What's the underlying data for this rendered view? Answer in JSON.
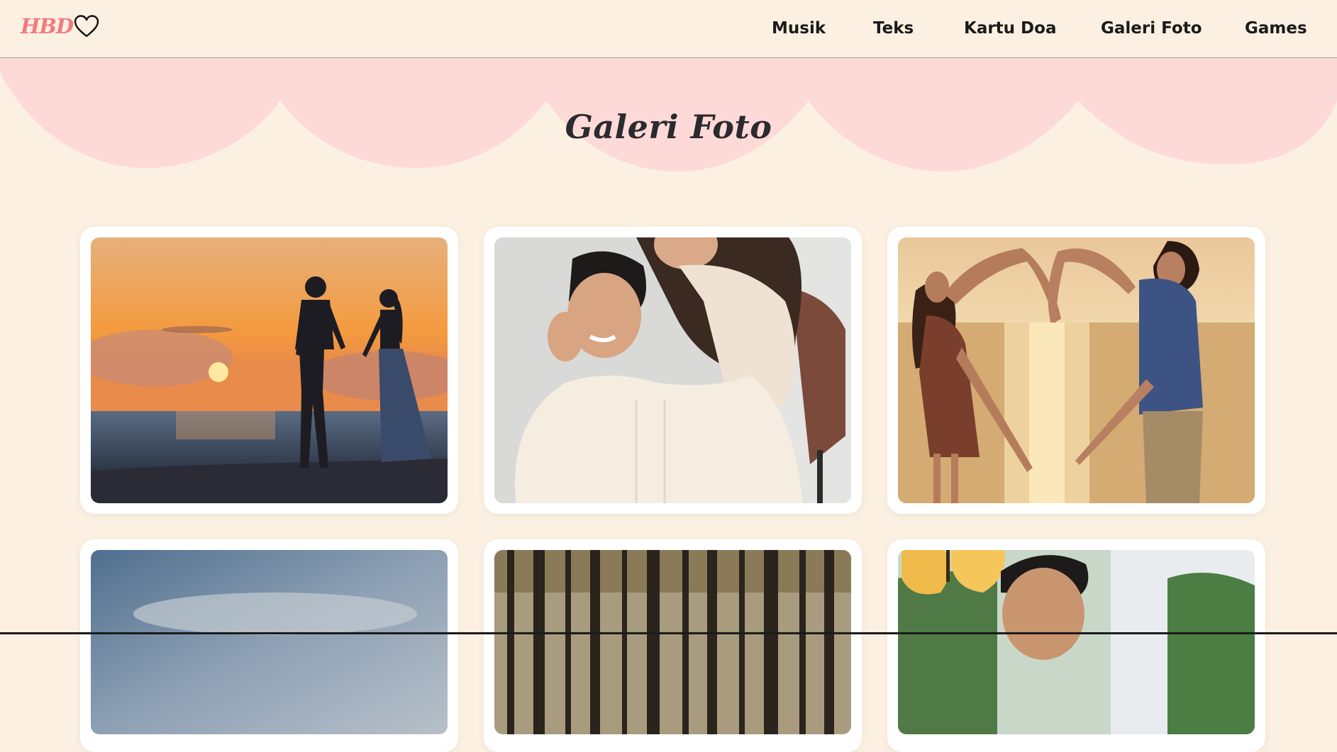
{
  "header": {
    "logo_text": "HBD",
    "nav": [
      "Musik",
      "Teks",
      "Kartu Doa",
      "Galeri Foto",
      "Games"
    ]
  },
  "page": {
    "title": "Galeri Foto"
  },
  "gallery": {
    "photos": [
      {
        "alt": "couple-beach-sunset"
      },
      {
        "alt": "couple-studio-embrace"
      },
      {
        "alt": "couple-heart-hands-sea"
      },
      {
        "alt": "sky-clouds"
      },
      {
        "alt": "forest-trees"
      },
      {
        "alt": "man-smiling-butterfly"
      }
    ]
  },
  "colors": {
    "background": "#fcf0e2",
    "scallop": "#fddad8",
    "logo": "#f27a7f",
    "text": "#1a1a1a"
  }
}
